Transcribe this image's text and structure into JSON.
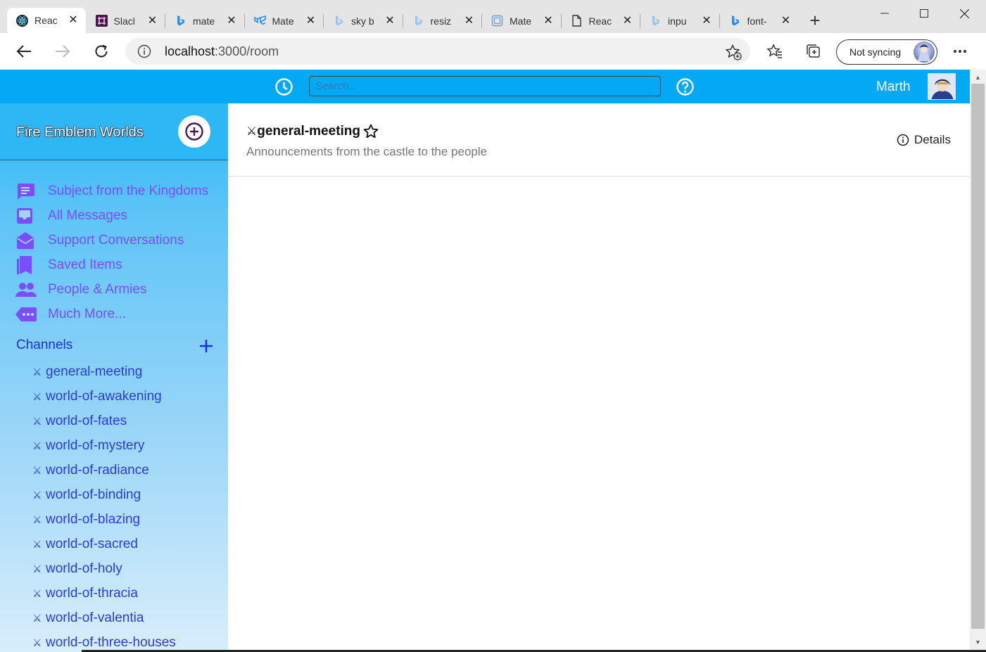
{
  "browser": {
    "tabs": [
      {
        "title": "Reac",
        "icon": "react-icon",
        "color": "#61dafb",
        "active": true
      },
      {
        "title": "Slacl",
        "icon": "slack-icon",
        "color": "#4a154b"
      },
      {
        "title": "mate",
        "icon": "bing-icon",
        "color": "#2f8cf0"
      },
      {
        "title": "Mate",
        "icon": "material-ui-icon",
        "color": "#2f8cf0"
      },
      {
        "title": "sky b",
        "icon": "bing-icon",
        "color": "#9fc4ee"
      },
      {
        "title": "resiz",
        "icon": "bing-icon",
        "color": "#9fc4ee"
      },
      {
        "title": "Mate",
        "icon": "page-frame-icon",
        "color": "#6aa0d8"
      },
      {
        "title": "Reac",
        "icon": "document-icon",
        "color": "#333333"
      },
      {
        "title": "inpu",
        "icon": "bing-icon",
        "color": "#9fc4ee"
      },
      {
        "title": "font-",
        "icon": "bing-icon",
        "color": "#2f8cf0"
      }
    ],
    "url_host": "localhost",
    "url_path": ":3000/room",
    "sync_label": "Not syncing"
  },
  "header": {
    "search_placeholder": "Search..",
    "username": "Marth",
    "accent": "#03a9f4"
  },
  "sidebar": {
    "workspace_name": "Fire Emblem Worlds",
    "nav_items": [
      {
        "label": "Subject from the Kingdoms",
        "icon": "chat-icon"
      },
      {
        "label": "All Messages",
        "icon": "inbox-icon"
      },
      {
        "label": "Support Conversations",
        "icon": "drafts-icon"
      },
      {
        "label": "Saved Items",
        "icon": "bookmarks-icon"
      },
      {
        "label": "People & Armies",
        "icon": "people-icon"
      },
      {
        "label": "Much More...",
        "icon": "more-icon"
      }
    ],
    "channels_label": "Channels",
    "channels": [
      "general-meeting",
      "world-of-awakening",
      "world-of-fates",
      "world-of-mystery",
      "world-of-radiance",
      "world-of-binding",
      "world-of-blazing",
      "world-of-sacred",
      "world-of-holy",
      "world-of-thracia",
      "world-of-valentia",
      "world-of-three-houses"
    ],
    "sword_glyph": "⚔"
  },
  "room": {
    "name": "general-meeting",
    "description": "Announcements from the castle to the people",
    "details_label": "Details"
  }
}
